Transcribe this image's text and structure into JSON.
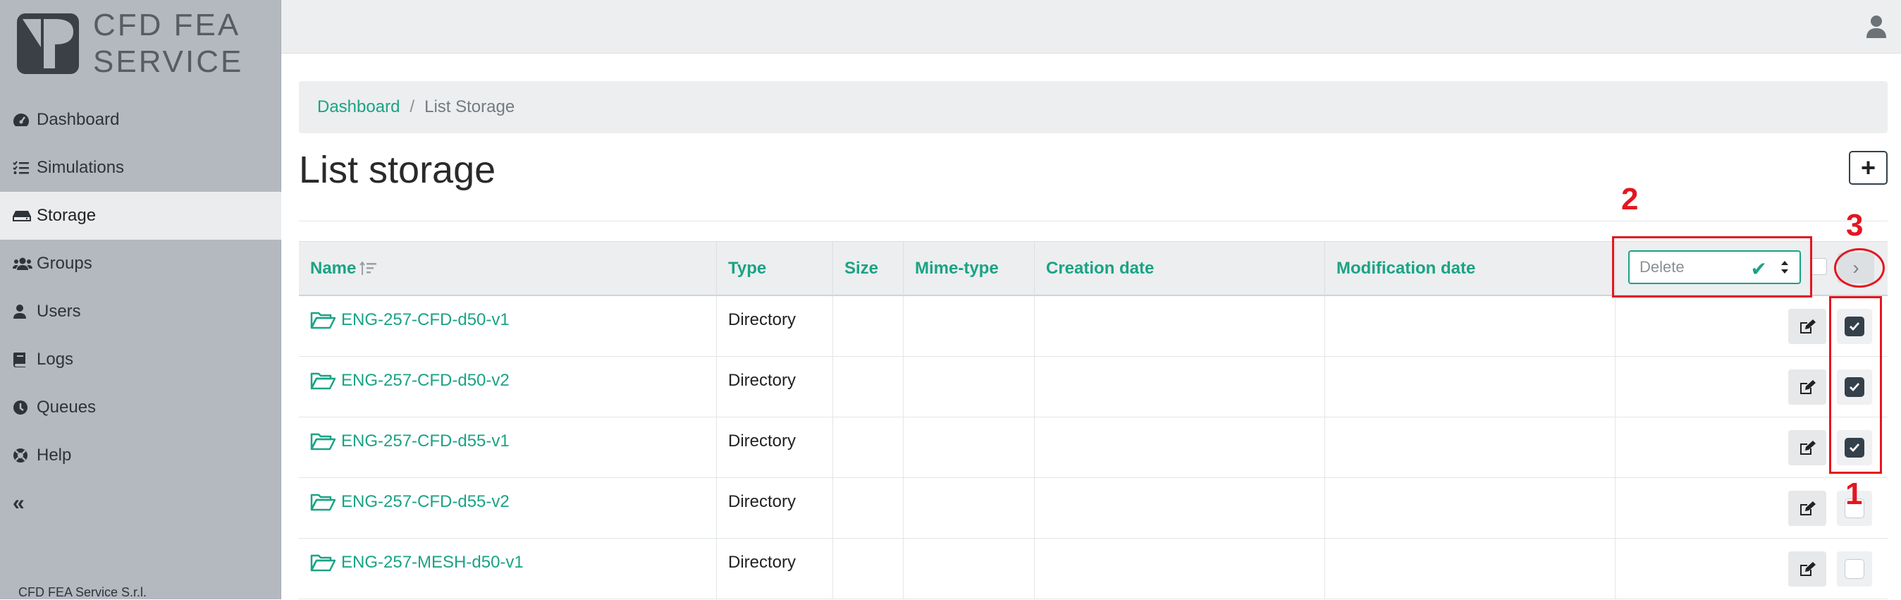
{
  "brand": {
    "line1": "CFD FEA",
    "line2": "SERVICE",
    "footer": "CFD FEA Service S.r.l."
  },
  "sidebar": {
    "items": [
      {
        "label": "Dashboard",
        "icon": "gauge-icon",
        "active": false
      },
      {
        "label": "Simulations",
        "icon": "tasks-icon",
        "active": false
      },
      {
        "label": "Storage",
        "icon": "hdd-icon",
        "active": true
      },
      {
        "label": "Groups",
        "icon": "users-icon",
        "active": false
      },
      {
        "label": "Users",
        "icon": "user-icon",
        "active": false
      },
      {
        "label": "Logs",
        "icon": "book-icon",
        "active": false
      },
      {
        "label": "Queues",
        "icon": "clock-icon",
        "active": false
      },
      {
        "label": "Help",
        "icon": "lifebuoy-icon",
        "active": false
      }
    ],
    "collapse_label": "«"
  },
  "breadcrumb": {
    "home": "Dashboard",
    "separator": "/",
    "current": "List Storage"
  },
  "page": {
    "title": "List storage",
    "add_label": "+"
  },
  "table": {
    "columns": {
      "name": "Name",
      "type": "Type",
      "size": "Size",
      "mime": "Mime-type",
      "created": "Creation date",
      "modified": "Modification date"
    },
    "action_select": {
      "value": "Delete",
      "check": "✔"
    },
    "go_label": "›",
    "rows": [
      {
        "name": "ENG-257-CFD-d50-v1",
        "type": "Directory",
        "checked": true
      },
      {
        "name": "ENG-257-CFD-d50-v2",
        "type": "Directory",
        "checked": true
      },
      {
        "name": "ENG-257-CFD-d55-v1",
        "type": "Directory",
        "checked": true
      },
      {
        "name": "ENG-257-CFD-d55-v2",
        "type": "Directory",
        "checked": false
      },
      {
        "name": "ENG-257-MESH-d50-v1",
        "type": "Directory",
        "checked": false
      }
    ]
  },
  "annotations": {
    "one": "1",
    "two": "2",
    "three": "3"
  },
  "colors": {
    "accent": "#1aa385",
    "annotation": "#e4161f",
    "sidebar": "#b3b9bf"
  }
}
